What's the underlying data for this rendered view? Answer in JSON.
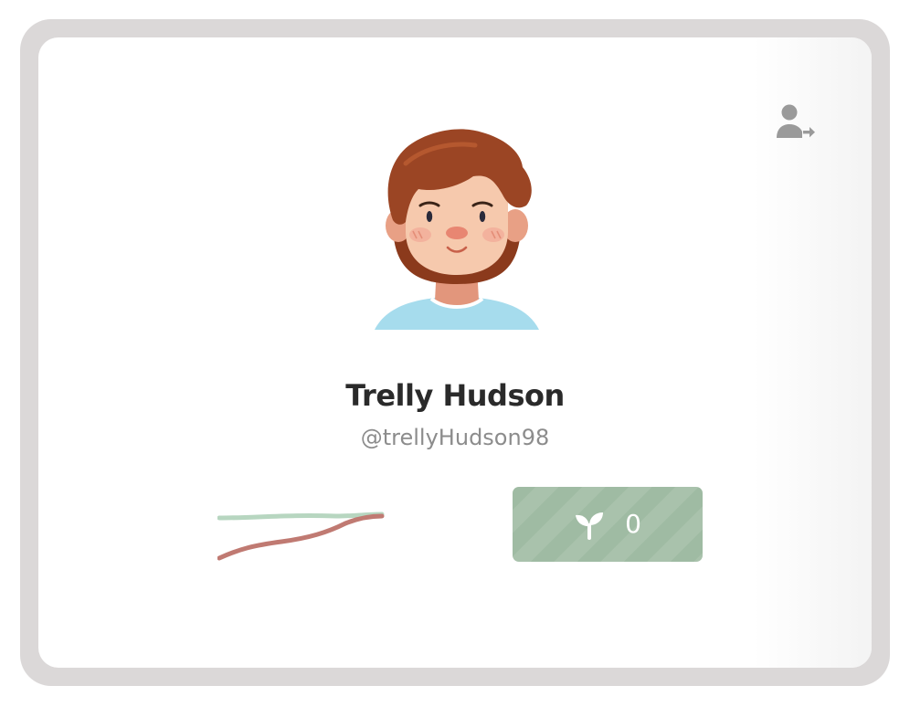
{
  "profile": {
    "name": "Trelly Hudson",
    "handle": "@trellyHudson98"
  },
  "actions": {
    "logout_icon": "user-logout-icon",
    "sprout": {
      "icon": "sprout-icon",
      "count": "0"
    }
  },
  "avatar": {
    "icon": "avatar-illustration"
  },
  "colors": {
    "frame": "#dbd8d8",
    "card": "#ffffff",
    "name_text": "#2a2a2a",
    "handle_text": "#8c8c8c",
    "sprout_button": "#9fbba3",
    "sparkline_green": "#b7d6c0",
    "sparkline_red": "#c07a72",
    "icon_gray": "#9a9a9a"
  }
}
